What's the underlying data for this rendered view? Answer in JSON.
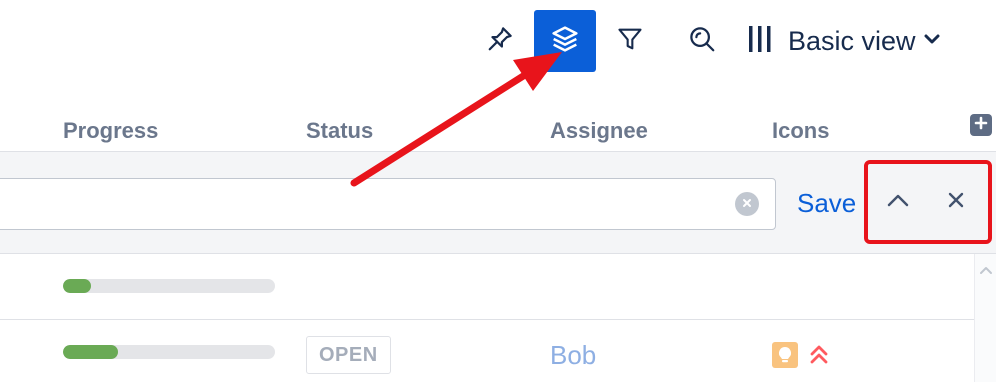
{
  "toolbar": {
    "view_label": "Basic view",
    "icons": [
      "pin-icon",
      "layers-icon",
      "filter-icon",
      "search-icon",
      "columns-icon",
      "chevron-down-icon"
    ]
  },
  "columns": {
    "progress": "Progress",
    "status": "Status",
    "assignee": "Assignee",
    "icons": "Icons"
  },
  "filter_bar": {
    "search_value": "",
    "save_label": "Save"
  },
  "rows": [
    {
      "progress": 0.13
    },
    {
      "progress": 0.26,
      "status": "OPEN",
      "assignee": "Bob",
      "icons": [
        "lightbulb-icon",
        "highest-priority-icon"
      ]
    }
  ],
  "colors": {
    "accent": "#0b5fd8",
    "annotation": "#e8141b",
    "progress_fill": "#6aaa55"
  }
}
